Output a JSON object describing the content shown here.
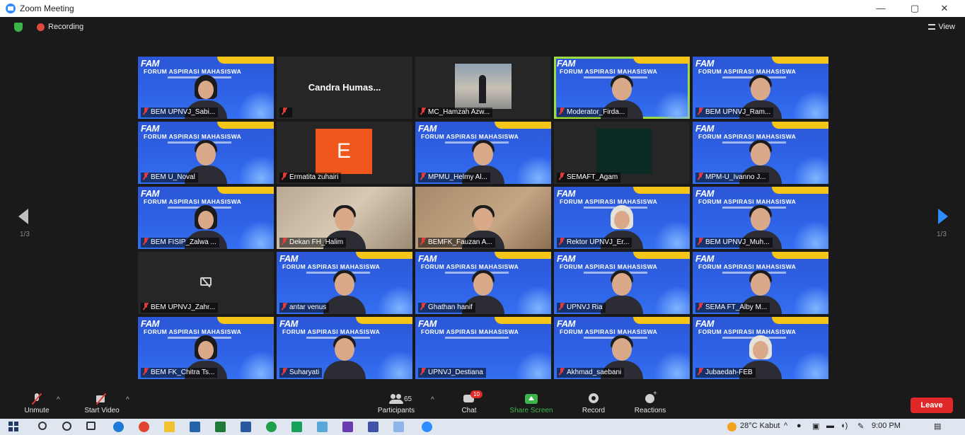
{
  "window": {
    "title": "Zoom Meeting",
    "minimize": "—",
    "maximize": "▢",
    "close": "✕"
  },
  "top_bar": {
    "recording_label": "Recording",
    "view_label": "View"
  },
  "pagination": {
    "left_page": "1/3",
    "right_page": "1/3"
  },
  "banner": {
    "logo": "FAM",
    "title": "FORUM ASPIRASI MAHASISWA"
  },
  "tiles": [
    {
      "name": "BEM UPNVJ_Sabi...",
      "type": "fam",
      "muted": true,
      "person": "hijab"
    },
    {
      "name": "",
      "type": "name-only",
      "display_name": "Candra  Humas...",
      "muted": true
    },
    {
      "name": "MC_Hamzah Azw...",
      "type": "inner-video",
      "muted": true
    },
    {
      "name": "Moderator_Firda...",
      "type": "fam",
      "muted": true,
      "active": true,
      "person": "plain"
    },
    {
      "name": "BEM UPNVJ_Ram...",
      "type": "fam",
      "muted": true,
      "person": "plain"
    },
    {
      "name": "BEM U_Noval",
      "type": "fam",
      "muted": true,
      "person": "plain"
    },
    {
      "name": "Ermatita zuhairi",
      "type": "avatar",
      "avatar_letter": "E",
      "muted": true
    },
    {
      "name": "MPMU_Helmy Al...",
      "type": "fam",
      "muted": true,
      "person": "plain"
    },
    {
      "name": "SEMAFT_Agam",
      "type": "dark-square",
      "muted": true
    },
    {
      "name": "MPM-U_Ivanno J...",
      "type": "fam",
      "muted": true,
      "person": "plain"
    },
    {
      "name": "BEM FISIP_Zalwa ...",
      "type": "fam",
      "muted": true,
      "person": "hijab"
    },
    {
      "name": "Dekan FH_Halim",
      "type": "photo1",
      "muted": true,
      "person": "plain"
    },
    {
      "name": "BEMFK_Fauzan A...",
      "type": "photo2",
      "muted": true,
      "person": "plain"
    },
    {
      "name": "Rektor UPNVJ_Er...",
      "type": "fam",
      "muted": true,
      "person": "hijab-light"
    },
    {
      "name": "BEM UPNVJ_Muh...",
      "type": "fam",
      "muted": true,
      "person": "plain"
    },
    {
      "name": "BEM UPNVJ_Zahr...",
      "type": "cam-off",
      "muted": true
    },
    {
      "name": "antar venus",
      "type": "fam",
      "muted": true,
      "person": "plain"
    },
    {
      "name": "Ghathan hanif",
      "type": "fam",
      "muted": true,
      "person": "plain"
    },
    {
      "name": "UPNVJ Ria",
      "type": "fam",
      "muted": true,
      "person": "plain"
    },
    {
      "name": "SEMA FT_Alby M...",
      "type": "fam",
      "muted": true,
      "person": "plain"
    },
    {
      "name": "BEM FK_Chitra Ts...",
      "type": "fam",
      "muted": true,
      "person": "hijab"
    },
    {
      "name": "Suharyati",
      "type": "fam",
      "muted": true,
      "person": "plain"
    },
    {
      "name": "UPNVJ_Destiana",
      "type": "fam",
      "muted": true,
      "person": "none"
    },
    {
      "name": "Akhmad_saebani",
      "type": "fam",
      "muted": true,
      "person": "plain"
    },
    {
      "name": "Jubaedah-FEB",
      "type": "fam",
      "muted": true,
      "person": "hijab-light"
    }
  ],
  "toolbar": {
    "unmute": "Unmute",
    "start_video": "Start Video",
    "participants": "Participants",
    "participants_count": "65",
    "chat": "Chat",
    "chat_badge": "10",
    "share_screen": "Share Screen",
    "record": "Record",
    "reactions": "Reactions",
    "leave": "Leave"
  },
  "taskbar": {
    "weather": "28°C  Kabut",
    "time": "9:00 PM"
  },
  "colors": {
    "accent": "#2d8cff",
    "leave": "#e02828",
    "active_speaker": "#9ddc3c",
    "share": "#3bb54a"
  }
}
